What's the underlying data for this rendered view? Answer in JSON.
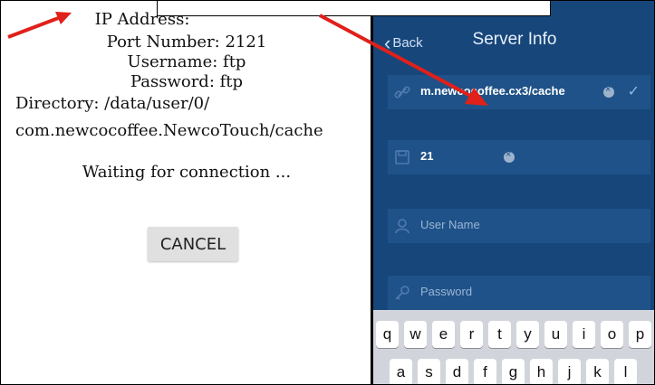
{
  "left_panel": {
    "ip_label": "IP Address: ",
    "port": "Port Number: 2121",
    "username": "Username: ftp",
    "password": "Password: ftp",
    "directory_line1": "Directory: /data/user/0/",
    "directory_line2": "com.newcocoffee.NewcoTouch/cache",
    "status": "Waiting for connection ...",
    "cancel_label": "CANCEL"
  },
  "right_panel": {
    "back_label": "Back",
    "title": "Server Info",
    "fields": {
      "host_value": "m.newcocoffee.cx3/cache",
      "port_value": "21",
      "username_placeholder": "User Name",
      "password_placeholder": "Password"
    },
    "keyboard": {
      "row1": [
        "q",
        "w",
        "e",
        "r",
        "t",
        "y",
        "u",
        "i",
        "o",
        "p"
      ],
      "row2": [
        "a",
        "s",
        "d",
        "f",
        "g",
        "h",
        "j",
        "k",
        "l"
      ]
    }
  },
  "colors": {
    "ios_bg": "#17467a",
    "field_bg": "#1f5288",
    "arrow": "#e0201a",
    "button_bg": "#e0e0e0"
  }
}
